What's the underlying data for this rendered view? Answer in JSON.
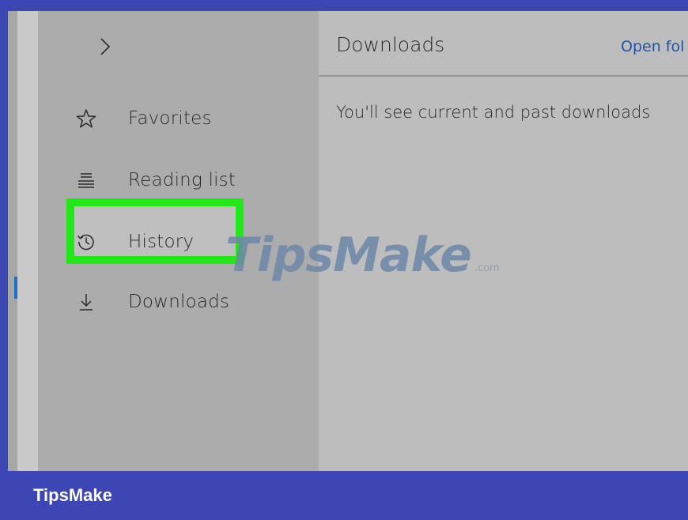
{
  "hub": {
    "expand_icon": "chevron-right-icon",
    "items": [
      {
        "id": "favorites",
        "label": "Favorites",
        "icon": "star-icon"
      },
      {
        "id": "reading-list",
        "label": "Reading list",
        "icon": "reading-list-icon"
      },
      {
        "id": "history",
        "label": "History",
        "icon": "history-icon"
      },
      {
        "id": "downloads",
        "label": "Downloads",
        "icon": "download-icon"
      }
    ],
    "highlighted_item": "history",
    "selected_item": "downloads"
  },
  "panel": {
    "title": "Downloads",
    "open_folder_label": "Open fol",
    "empty_message": "You'll see current and past downloads"
  },
  "watermark": {
    "brand": "TipsMake",
    "suffix": ".com"
  },
  "footer": {
    "brand": "TipsMake"
  },
  "colors": {
    "frame": "#3d46b5",
    "highlight": "#22e81a",
    "selected_indicator": "#1d6ec9",
    "link": "#1c56a6"
  }
}
